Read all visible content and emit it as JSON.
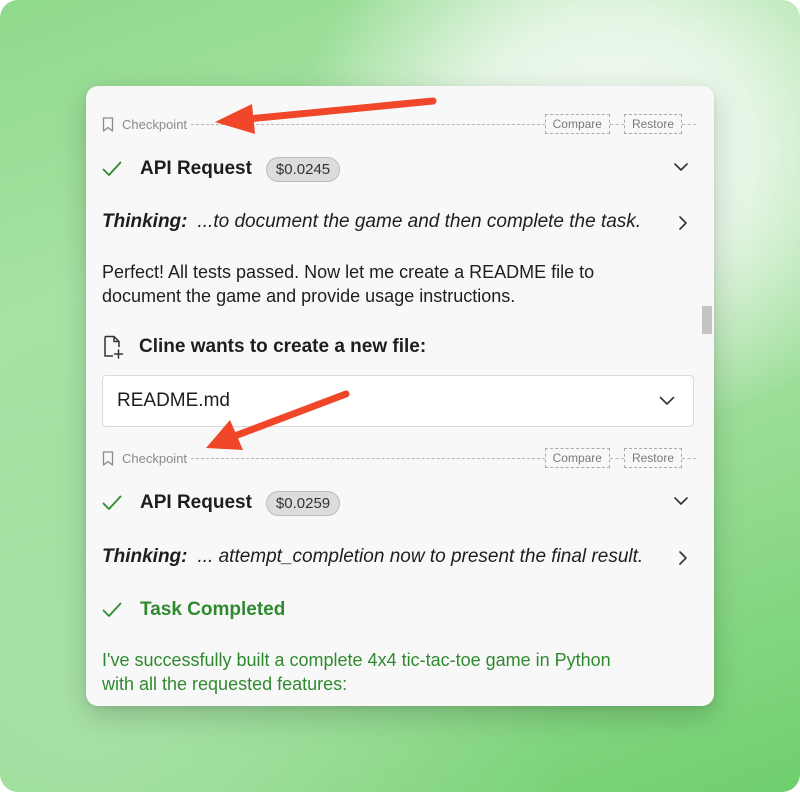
{
  "checkpoints": [
    {
      "label": "Checkpoint",
      "compare_label": "Compare",
      "restore_label": "Restore"
    },
    {
      "label": "Checkpoint",
      "compare_label": "Compare",
      "restore_label": "Restore"
    }
  ],
  "api_requests": [
    {
      "title": "API Request",
      "cost": "$0.0245"
    },
    {
      "title": "API Request",
      "cost": "$0.0259"
    }
  ],
  "thinking": [
    {
      "label": "Thinking:",
      "text": "...to document the game and then complete the task."
    },
    {
      "label": "Thinking:",
      "text": "... attempt_completion now to present the final result."
    }
  ],
  "message": {
    "line1": "Perfect! All tests passed. Now let me create a README file to",
    "line2": "document the game and provide usage instructions."
  },
  "file_create": {
    "label": "Cline wants to create a new file:",
    "file_name": "README.md"
  },
  "task": {
    "title": "Task Completed",
    "line1": "I've successfully built a complete 4x4 tic-tac-toe game in Python",
    "line2": "with all the requested features:"
  },
  "colors": {
    "accent_green": "#2f8a2f",
    "annotation_arrow": "#f0462a",
    "panel_background": "#f8f8f8"
  },
  "icons": [
    "bookmark-icon",
    "check-icon",
    "chevron-down-icon",
    "chevron-right-icon",
    "file-plus-icon"
  ]
}
